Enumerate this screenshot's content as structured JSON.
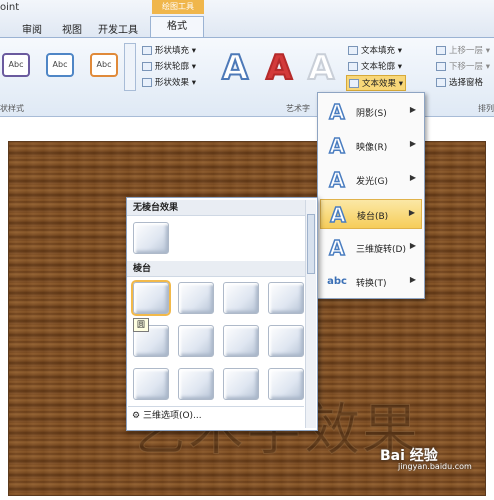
{
  "window": {
    "title_fragment": "oint",
    "contextual_tab": "绘图工具"
  },
  "tabs": [
    {
      "label": "审阅"
    },
    {
      "label": "视图"
    },
    {
      "label": "开发工具"
    },
    {
      "label": "格式"
    }
  ],
  "shape_styles": {
    "thumbs": [
      "Abc",
      "Abc",
      "Abc"
    ],
    "fill": "形状填充",
    "outline": "形状轮廓",
    "effects": "形状效果",
    "group_label": "状样式"
  },
  "wordart": {
    "letters": [
      "A",
      "A",
      "A"
    ],
    "group_label": "艺术字",
    "text_fill": "文本填充",
    "text_outline": "文本轮廓",
    "text_effects": "文本效果"
  },
  "arrange": {
    "bring_forward": "上移一层",
    "send_backward": "下移一层",
    "selection_pane": "选择窗格",
    "group_label": "排列"
  },
  "effects_menu": [
    {
      "label": "阴影(S)",
      "icon": "A"
    },
    {
      "label": "映像(R)",
      "icon": "A"
    },
    {
      "label": "发光(G)",
      "icon": "A"
    },
    {
      "label": "棱台(B)",
      "icon": "A"
    },
    {
      "label": "三维旋转(D)",
      "icon": "A"
    },
    {
      "label": "转换(T)",
      "icon": "abc"
    }
  ],
  "bevel_gallery": {
    "no_bevel_header": "无棱台效果",
    "bevel_header": "棱台",
    "tooltip": "圆",
    "options_link": "三维选项(O)..."
  },
  "slide": {
    "art_text": "艺术字效果"
  },
  "watermark": {
    "brand": "Bai 经验",
    "url": "jingyan.baidu.com"
  }
}
